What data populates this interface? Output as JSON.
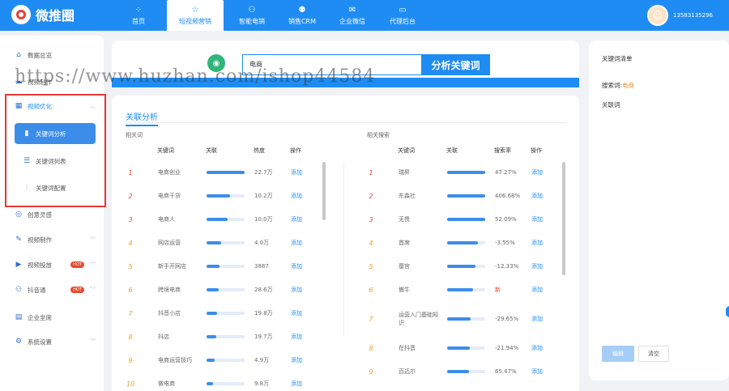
{
  "brand": {
    "name": "微推圈"
  },
  "nav": [
    {
      "label": "首页",
      "icon": "grid-icon",
      "glyph": "⁘"
    },
    {
      "label": "短视频营销",
      "icon": "star-icon",
      "glyph": "☆",
      "active": true
    },
    {
      "label": "智能电销",
      "icon": "robot-icon",
      "glyph": "⚇"
    },
    {
      "label": "销售CRM",
      "icon": "users-icon",
      "glyph": "⚉"
    },
    {
      "label": "企业微信",
      "icon": "wechat-icon",
      "glyph": "✉"
    },
    {
      "label": "代理后台",
      "icon": "monitor-icon",
      "glyph": "▭"
    }
  ],
  "user": {
    "phone": "13583135296"
  },
  "sidebar": {
    "items": [
      {
        "label": "数据总览",
        "icon": "home-icon"
      },
      {
        "label": "视频制作",
        "icon": "cloud-icon"
      },
      {
        "label": "视频优化",
        "icon": "chart-icon"
      },
      {
        "label": "关键词分析",
        "icon": "bar-chart-icon"
      },
      {
        "label": "关键词列表",
        "icon": "list-icon"
      },
      {
        "label": "关键词配置",
        "icon": "sliders-icon"
      },
      {
        "label": "创意灵感",
        "icon": "bulb-icon"
      },
      {
        "label": "视频制作",
        "icon": "edit-icon"
      },
      {
        "label": "视频投放",
        "icon": "play-icon",
        "badge": "HOT"
      },
      {
        "label": "抖音通",
        "icon": "people-icon",
        "badge": "HOT"
      },
      {
        "label": "企业坐席",
        "icon": "building-icon"
      },
      {
        "label": "系统设置",
        "icon": "gear-icon"
      }
    ]
  },
  "search": {
    "value": "电商",
    "button": "分析关键词"
  },
  "section": {
    "title": "关联分析"
  },
  "left_table": {
    "label": "相关词",
    "headers": [
      "关键词",
      "关联",
      "热度",
      "操作"
    ],
    "rows": [
      {
        "rank": "1",
        "keyword": "电商创业",
        "relevance": 1.0,
        "value": "22.7万",
        "action": "添加"
      },
      {
        "rank": "2",
        "keyword": "电商干货",
        "relevance": 0.62,
        "value": "10.2万",
        "action": "添加"
      },
      {
        "rank": "3",
        "keyword": "电商人",
        "relevance": 0.55,
        "value": "10.0万",
        "action": "添加"
      },
      {
        "rank": "4",
        "keyword": "网店运营",
        "relevance": 0.38,
        "value": "4.0万",
        "action": "添加"
      },
      {
        "rank": "5",
        "keyword": "新手开网店",
        "relevance": 0.35,
        "value": "3887",
        "action": "添加"
      },
      {
        "rank": "6",
        "keyword": "跨境电商",
        "relevance": 0.32,
        "value": "28.6万",
        "action": "添加"
      },
      {
        "rank": "7",
        "keyword": "抖音小店",
        "relevance": 0.28,
        "value": "19.8万",
        "action": "添加"
      },
      {
        "rank": "8",
        "keyword": "抖店",
        "relevance": 0.25,
        "value": "19.7万",
        "action": "添加"
      },
      {
        "rank": "9",
        "keyword": "电商运营技巧",
        "relevance": 0.22,
        "value": "4.9万",
        "action": "添加"
      },
      {
        "rank": "10",
        "keyword": "做电商",
        "relevance": 0.18,
        "value": "9.8万",
        "action": "添加"
      }
    ]
  },
  "right_table": {
    "label": "相关搜索",
    "headers": [
      "关键词",
      "关联",
      "搜索率",
      "操作"
    ],
    "rows": [
      {
        "rank": "1",
        "keyword": "瑞昇",
        "relevance": 1.0,
        "value": "47.27%",
        "action": "添加"
      },
      {
        "rank": "2",
        "keyword": "东森社",
        "relevance": 1.0,
        "value": "406.68%",
        "action": "添加"
      },
      {
        "rank": "3",
        "keyword": "无畏",
        "relevance": 1.0,
        "value": "52.09%",
        "action": "添加"
      },
      {
        "rank": "4",
        "keyword": "首席",
        "relevance": 0.8,
        "value": "-3.55%",
        "action": "添加"
      },
      {
        "rank": "5",
        "keyword": "蚕宫",
        "relevance": 0.75,
        "value": "-12.33%",
        "action": "添加"
      },
      {
        "rank": "6",
        "keyword": "傲牛",
        "relevance": 0.68,
        "value": "新",
        "action": "添加",
        "is_new": true
      },
      {
        "rank": "7",
        "keyword": "运营入门基础知识",
        "relevance": 0.62,
        "value": "-29.65%",
        "action": "添加"
      },
      {
        "rank": "8",
        "keyword": "在抖音",
        "relevance": 0.6,
        "value": "-21.94%",
        "action": "添加"
      },
      {
        "rank": "9",
        "keyword": "百迈尔",
        "relevance": 0.58,
        "value": "65.47%",
        "action": "添加"
      }
    ]
  },
  "keyword_panel": {
    "title": "关键词清单",
    "search_label": "搜索词:",
    "search_value": "电商",
    "related_label": "关联词",
    "copy_button": "编辑",
    "clear_button": "清空"
  },
  "watermark": "https://www.huzhan.com/ishop44584",
  "colors": {
    "primary": "#1f8cf3",
    "hot": "#e84a2e",
    "rank_other": "#f59b22",
    "highlight_box": "#e53935"
  }
}
